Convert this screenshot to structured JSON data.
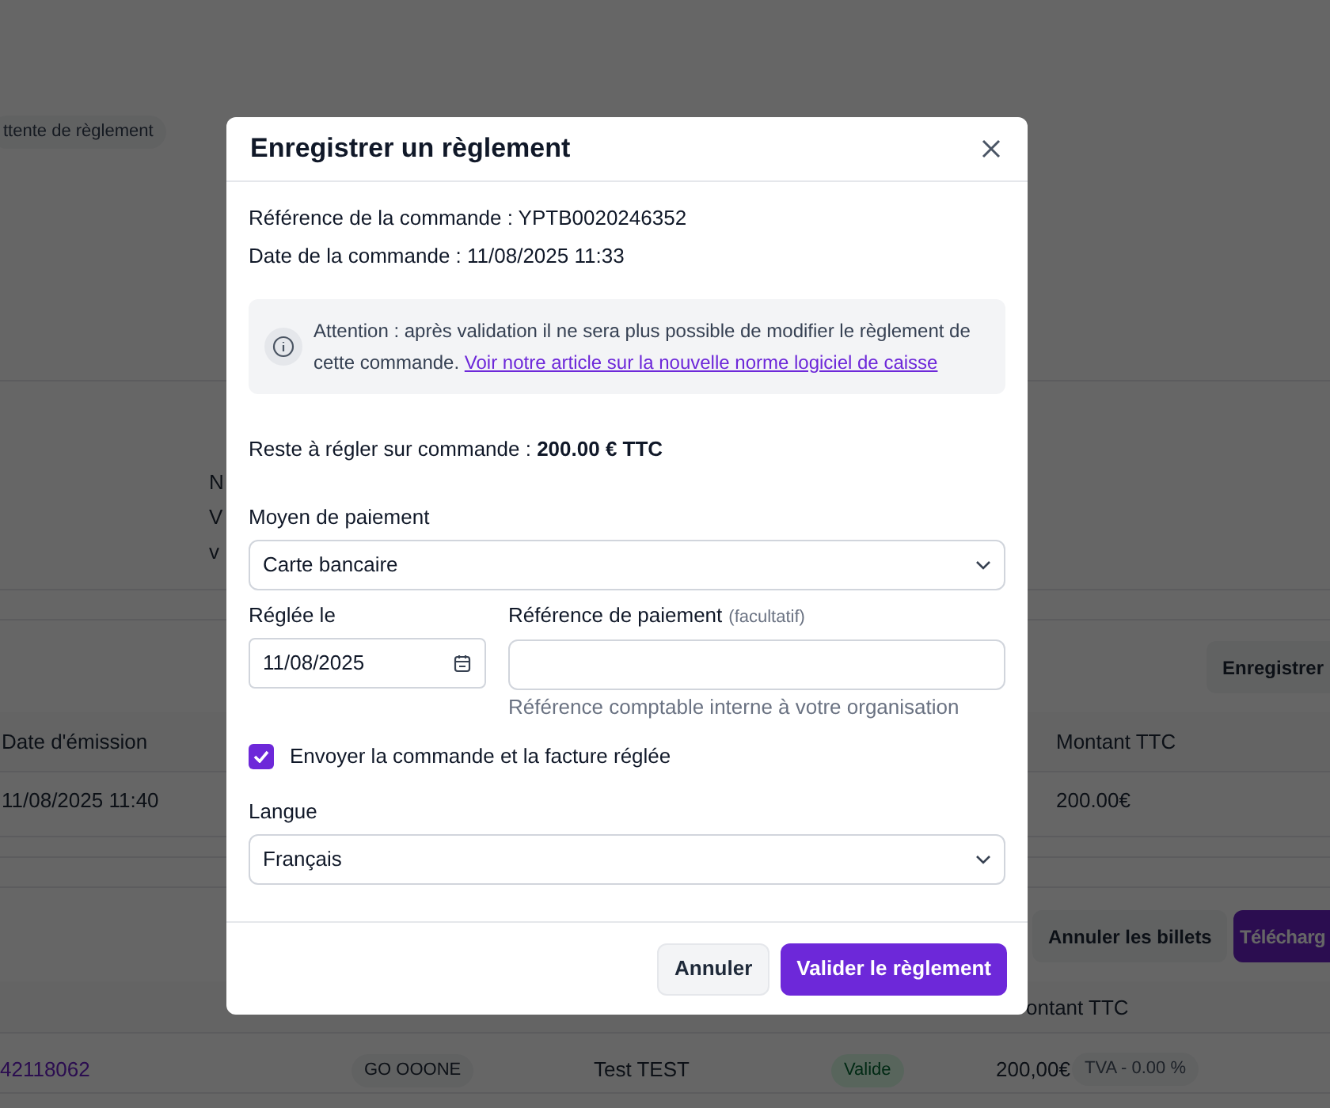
{
  "background": {
    "status_badge": "ttente de règlement",
    "fragments": [
      "N",
      "V",
      "v"
    ],
    "record_button": "Enregistrer",
    "invoices_table": {
      "columns": [
        "Date d'émission",
        "Montant TTC"
      ],
      "rows": [
        [
          "11/08/2025 11:40",
          "200.00€"
        ]
      ]
    },
    "actions": [
      {
        "label": "Annuler les billets",
        "kind": "secondary"
      },
      {
        "label": "Télécharg",
        "kind": "primary"
      }
    ],
    "tickets_table": {
      "columns": [
        "ontant TTC"
      ],
      "rows": [
        {
          "reference": "42118062",
          "event": "GO OOONE",
          "holder": "Test TEST",
          "status": "Valide",
          "amount": "200,00€",
          "vat": "TVA - 0.00 %"
        }
      ]
    }
  },
  "dialog": {
    "title": "Enregistrer un règlement",
    "order_reference": "Référence de la commande : YPTB0020246352",
    "order_date": "Date de la commande : 11/08/2025 11:33",
    "notice": {
      "text": "Attention : après validation il ne sera plus possible de modifier le règlement de cette commande.",
      "link": "Voir notre article sur la nouvelle norme logiciel de caisse"
    },
    "remaining": "Reste à régler sur commande : **200.00 € TTC**",
    "payment_method": {
      "label": "Moyen de paiement",
      "value": "Carte bancaire"
    },
    "paid_on": {
      "label": "Réglée le",
      "value": "11/08/2025"
    },
    "payment_reference": {
      "label": "Référence de paiement",
      "optional": "(facultatif)",
      "hint": "Référence comptable interne à votre organisation"
    },
    "send_invoice": {
      "label": "Envoyer la commande et la facture réglée",
      "checked": true
    },
    "language": {
      "label": "Langue",
      "value": "Français"
    },
    "buttons": [
      {
        "label": "Annuler",
        "kind": "secondary"
      },
      {
        "label": "Valider le règlement",
        "kind": "primary"
      }
    ]
  }
}
